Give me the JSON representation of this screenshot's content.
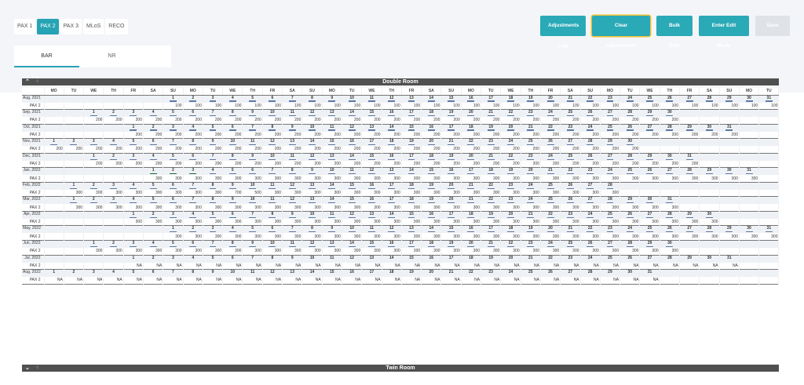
{
  "occupancy_tabs": [
    "PAX 1",
    "PAX 2",
    "PAX 3",
    "MLoS",
    "RECO"
  ],
  "active_occupancy": "PAX 2",
  "actions": {
    "log": "Adjustments Log",
    "clear": "Clear Adjustments",
    "bulk": "Bulk Edit",
    "edit": "Enter Edit Mode",
    "save": "Save"
  },
  "rate_tabs": [
    "BAR",
    "NR"
  ],
  "active_rate_tab": "BAR",
  "room_types": [
    {
      "name": "Double Room",
      "collapse_icon": "chevron-up-icon",
      "comment_icon": "comment-icon"
    },
    {
      "name": "Twin Room",
      "collapse_icon": "chevron-down-icon",
      "comment_icon": "comment-icon"
    }
  ],
  "weekdays": [
    "MO",
    "TU",
    "WE",
    "TH",
    "FR",
    "SA",
    "SU"
  ],
  "row_sublabel": "PAX 2",
  "months": [
    {
      "label": "Aug, 2021",
      "offset": 6,
      "days": 31,
      "value": "100"
    },
    {
      "label": "Sep, 2021",
      "offset": 2,
      "days": 30,
      "value": "200"
    },
    {
      "label": "Oct, 2021",
      "offset": 4,
      "days": 31,
      "value": "200"
    },
    {
      "label": "Nov, 2021",
      "offset": 0,
      "days": 30,
      "value": "200"
    },
    {
      "label": "Dec, 2021",
      "offset": 2,
      "days": 31,
      "value": "200"
    },
    {
      "label": "Jan, 2022",
      "offset": 5,
      "days": 31,
      "value": "300",
      "green_marks": [
        1,
        2,
        3
      ]
    },
    {
      "label": "Feb, 2022",
      "offset": 1,
      "days": 28,
      "value": "300",
      "special": {
        "9": "700",
        "10": "500"
      }
    },
    {
      "label": "Mar, 2022",
      "offset": 1,
      "days": 31,
      "value": "300"
    },
    {
      "label": "Apr, 2022",
      "offset": 4,
      "days": 30,
      "value": "300"
    },
    {
      "label": "May, 2022",
      "offset": 6,
      "days": 31,
      "value": "300"
    },
    {
      "label": "Jun, 2022",
      "offset": 2,
      "days": 30,
      "value": "300"
    },
    {
      "label": "Jul, 2022",
      "offset": 4,
      "days": 31,
      "value": "NA"
    },
    {
      "label": "Aug, 2022",
      "offset": 0,
      "days": 31,
      "value": "NA"
    }
  ],
  "colors": {
    "accent": "#27a4b4",
    "band": "#505050",
    "mark": "#5f7aa3",
    "mark_green": "#1e6b3a"
  }
}
